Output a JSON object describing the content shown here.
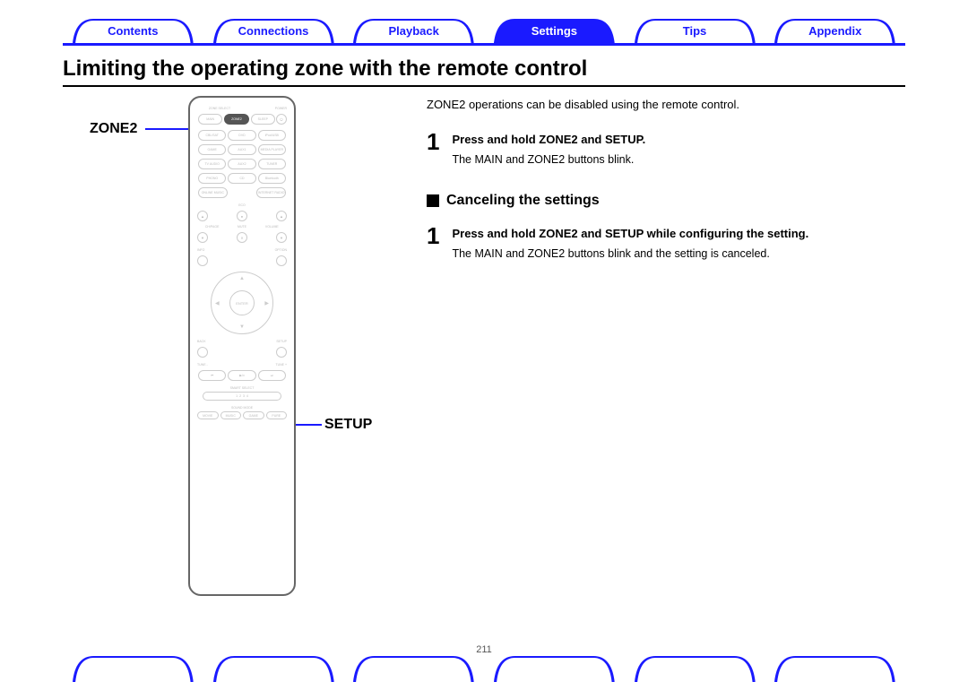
{
  "tabs": [
    "Contents",
    "Connections",
    "Playback",
    "Settings",
    "Tips",
    "Appendix"
  ],
  "active_tab_index": 3,
  "title": "Limiting the operating zone with the remote control",
  "callouts": {
    "zone2": "ZONE2",
    "setup": "SETUP"
  },
  "intro": "ZONE2 operations can be disabled using the remote control.",
  "step1": {
    "num": "1",
    "title": "Press and hold ZONE2 and SETUP.",
    "desc": "The MAIN and ZONE2 buttons blink."
  },
  "subheading": "Canceling the settings",
  "step2": {
    "num": "1",
    "title": "Press and hold ZONE2 and SETUP while configuring the setting.",
    "desc": "The MAIN and ZONE2 buttons blink and the setting is canceled."
  },
  "page_number": "211",
  "remote": {
    "top_labels": [
      "ZONE SELECT",
      "POWER"
    ],
    "zone_row": [
      "MAIN",
      "ZONE2",
      "SLEEP"
    ],
    "src_rows": [
      [
        "CBL/SAT",
        "DVD",
        "iPod/USB"
      ],
      [
        "GAME",
        "AUX1",
        "MEDIA PLAYER"
      ],
      [
        "TV AUDIO",
        "AUX2",
        "TUNER"
      ],
      [
        "PHONO",
        "CD",
        "Bluetooth"
      ],
      [
        "ONLINE MUSIC",
        "",
        "INTERNET RADIO"
      ]
    ],
    "mid_labels": [
      "CH/PAGE",
      "ECO",
      "MUTE",
      "VOLUME"
    ],
    "info_row": [
      "INFO",
      "OPTION"
    ],
    "back_row": [
      "BACK",
      "SETUP"
    ],
    "enter": "ENTER",
    "tune_row": [
      "TUNE -",
      "TUNE +"
    ],
    "play_icons": [
      "⏮",
      "▶/⏸",
      "⏭"
    ],
    "smart_select": "SMART SELECT",
    "smart_nums": [
      "1",
      "2",
      "3",
      "4"
    ],
    "sound_mode": "SOUND MODE",
    "sound_modes": [
      "MOVIE",
      "MUSIC",
      "GAME",
      "PURE"
    ]
  }
}
